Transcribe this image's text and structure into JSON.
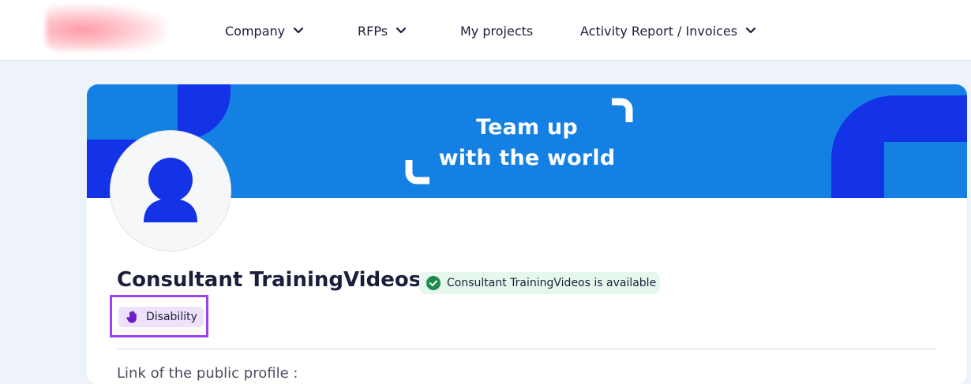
{
  "nav": {
    "items": [
      {
        "label": "Company",
        "has_dropdown": true
      },
      {
        "label": "RFPs",
        "has_dropdown": true
      },
      {
        "label": "My projects",
        "has_dropdown": false
      },
      {
        "label": "Activity Report / Invoices",
        "has_dropdown": true
      }
    ]
  },
  "banner": {
    "line1": "Team up",
    "line2": "with the world",
    "background_color": "#1580e3",
    "shape_color": "#1433e6"
  },
  "profile": {
    "name": "Consultant TrainingVideos",
    "availability": "Consultant TrainingVideos is available",
    "availability_icon": "check-circle-icon",
    "tag_label": "Disability",
    "tag_icon": "hand-icon",
    "public_profile_label": "Link of the public profile :"
  },
  "colors": {
    "accent": "#1433e6",
    "available_green": "#1f8a4c",
    "tag_purple": "#ede1fb",
    "highlight": "#9944f0"
  }
}
